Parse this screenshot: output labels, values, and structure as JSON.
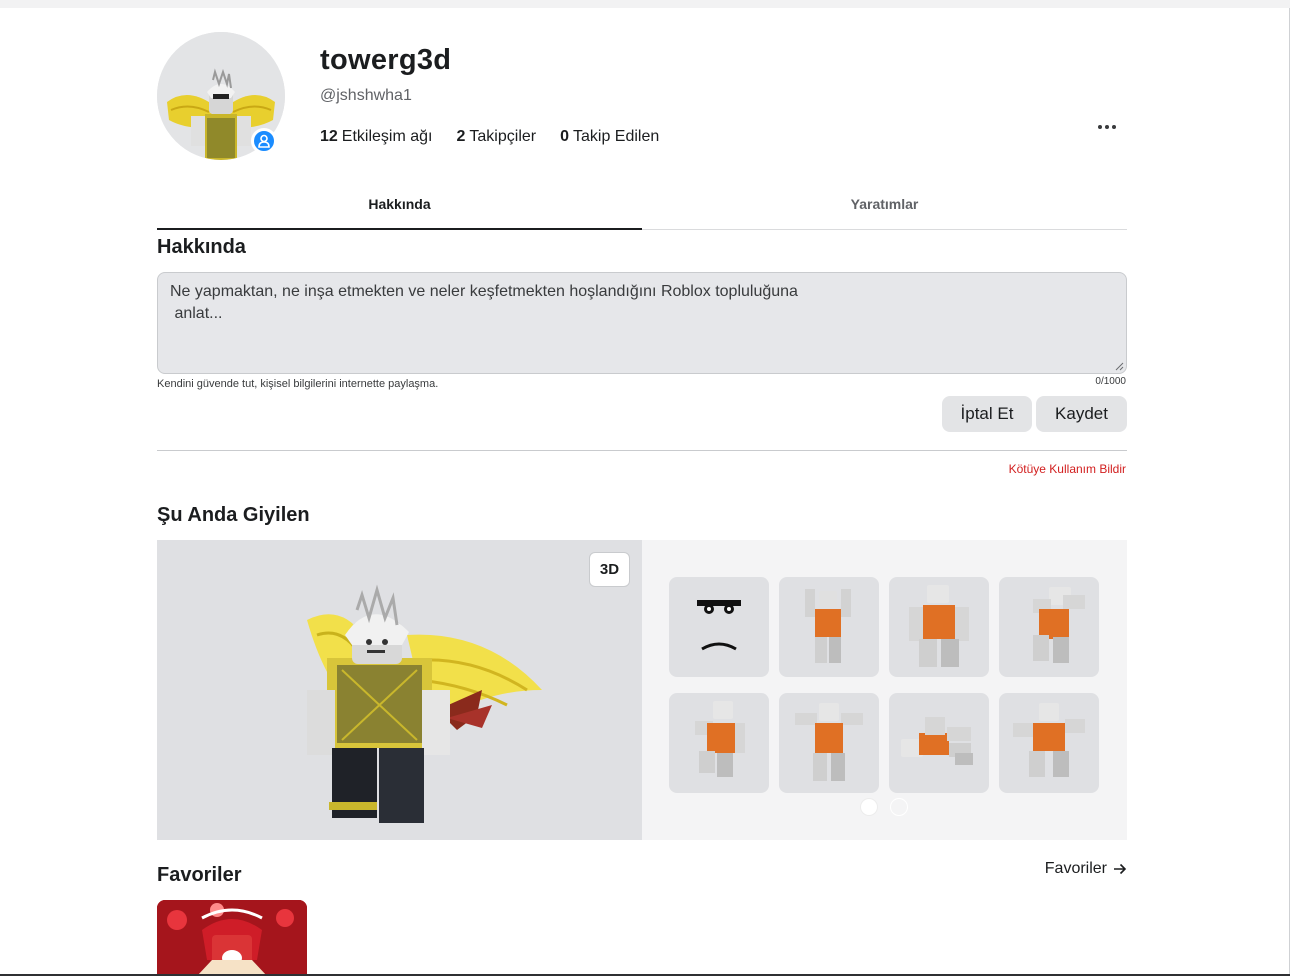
{
  "profile": {
    "display_name": "towerg3d",
    "username": "@jshshwha1",
    "stats": [
      {
        "count": "12",
        "label": "Etkileşim ağı"
      },
      {
        "count": "2",
        "label": "Takipçiler"
      },
      {
        "count": "0",
        "label": "Takip Edilen"
      }
    ]
  },
  "tabs": [
    "Hakkında",
    "Yaratımlar"
  ],
  "about": {
    "title": "Hakkında",
    "placeholder_line1": "Ne yapmaktan, ne inşa etmekten ve neler keşfetmekten hoşlandığını Roblox topluluğuna",
    "placeholder_line2": " anlat...",
    "hint": "Kendini güvende tut, kişisel bilgilerini internette paylaşma.",
    "counter": "0/1000",
    "cancel_label": "İptal Et",
    "save_label": "Kaydet",
    "report_label": "Kötüye Kullanım Bildir"
  },
  "wearing": {
    "title": "Şu Anda Giyilen",
    "view_toggle": "3D",
    "items": [
      "face",
      "emote-1",
      "emote-2",
      "emote-3",
      "emote-4",
      "emote-5",
      "emote-6",
      "emote-7"
    ],
    "page_count": 2,
    "current_page": 1
  },
  "favorites": {
    "title": "Favoriler",
    "link_label": "Favoriler"
  },
  "colors": {
    "accent_blue": "#1a8cff",
    "report_red": "#d21f1f",
    "panel_gray": "#dfe0e3"
  }
}
